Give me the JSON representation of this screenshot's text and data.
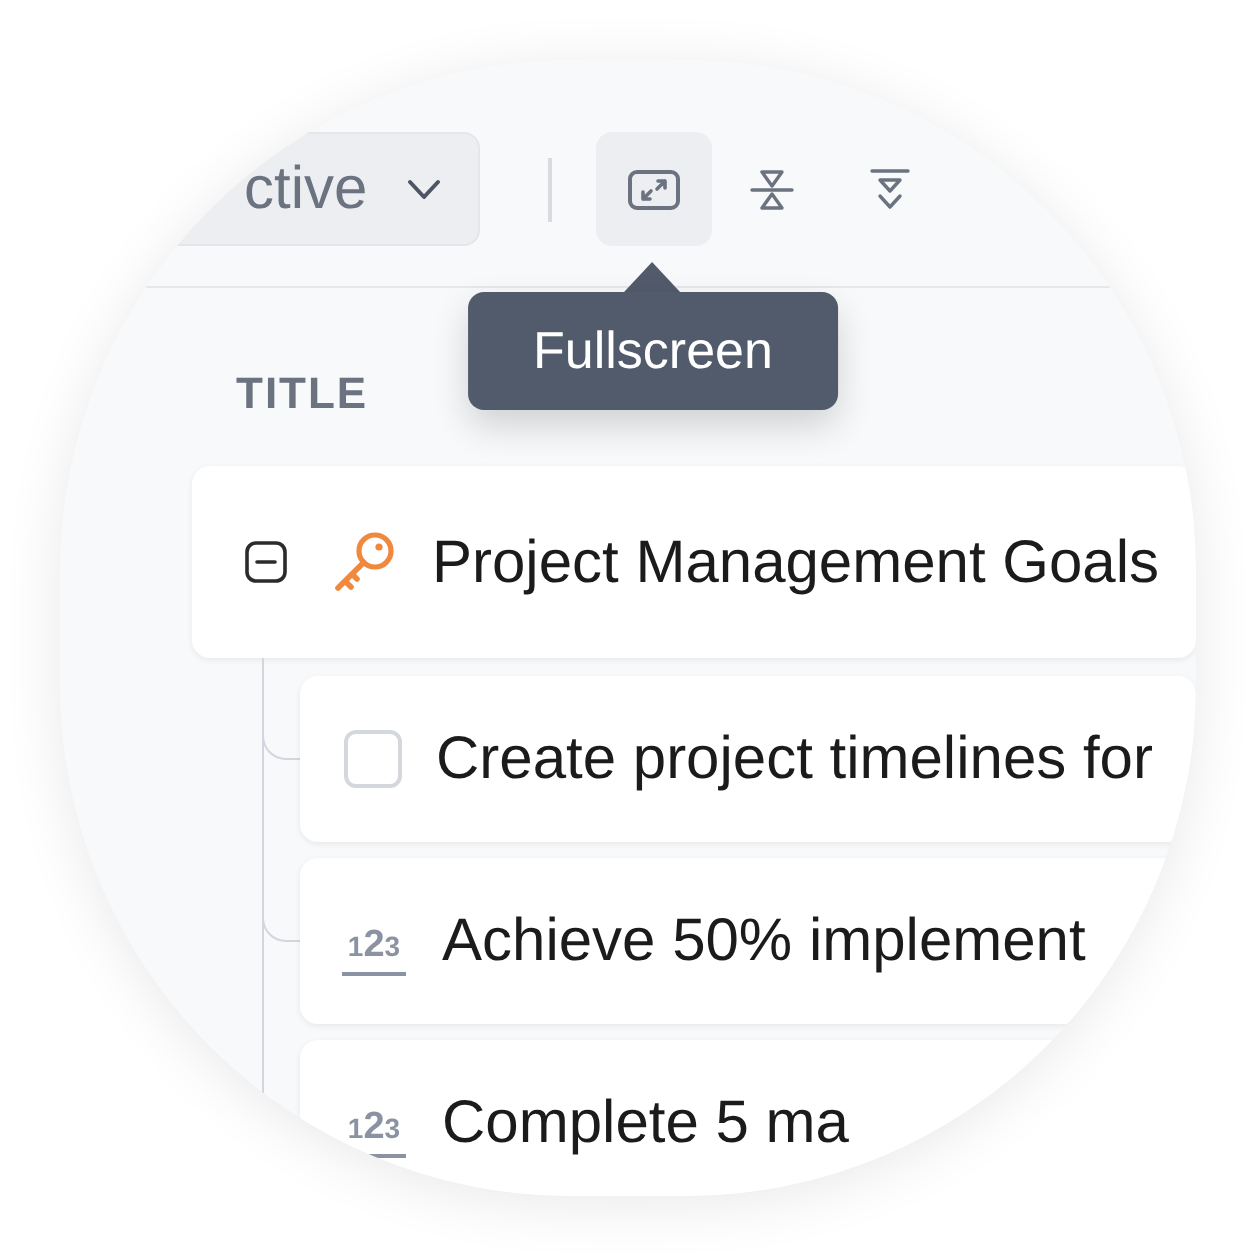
{
  "toolbar": {
    "filter": {
      "label": "ctive"
    },
    "buttons": [
      {
        "kind": "fullscreen",
        "hovered": true,
        "tooltip": "Fullscreen"
      },
      {
        "kind": "collapse_all",
        "hovered": false
      },
      {
        "kind": "expand_all",
        "hovered": false
      }
    ]
  },
  "table": {
    "columns": [
      "TITLE"
    ],
    "rows": [
      {
        "kind": "group",
        "title": "Project Management Goals",
        "expanded": true,
        "children": [
          {
            "kind": "checkbox",
            "checked": false,
            "title": "Create project timelines for"
          },
          {
            "kind": "number",
            "glyph": "123",
            "title": "Achieve 50% implement"
          },
          {
            "kind": "number",
            "glyph": "123",
            "title": "Complete 5 ma"
          }
        ]
      }
    ]
  }
}
